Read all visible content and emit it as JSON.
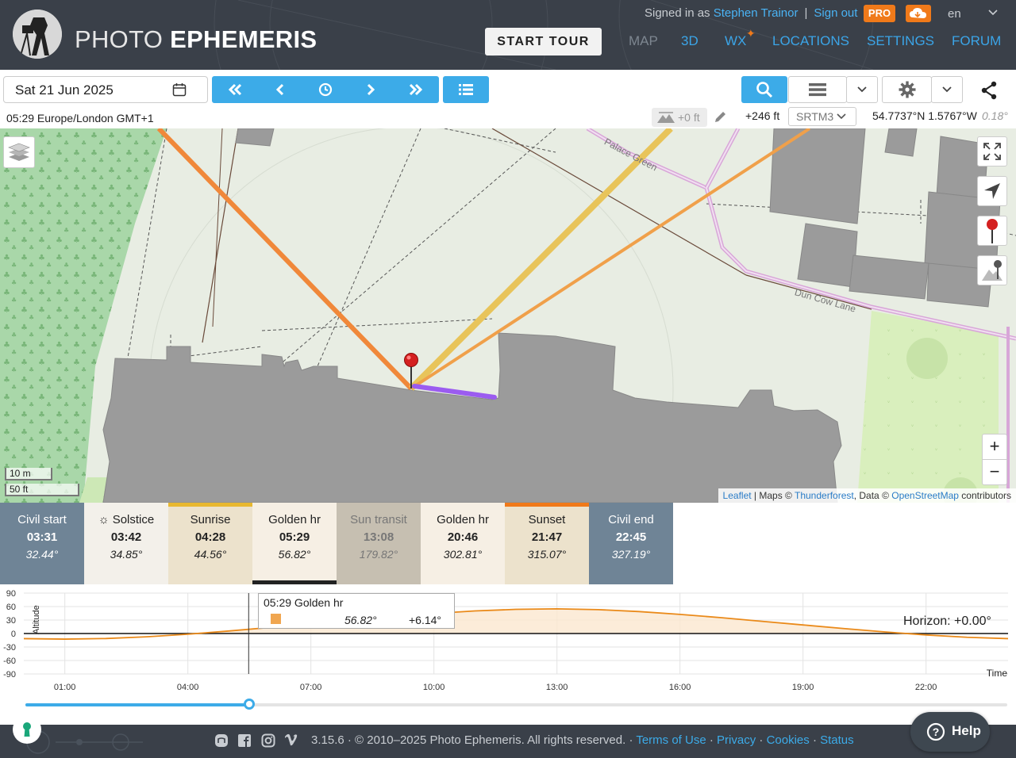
{
  "header": {
    "title_part1": "PHOTO",
    "title_part2": "EPHEMERIS",
    "signed_in_label": "Signed in as",
    "user_name": "Stephen Trainor",
    "sign_out": "Sign out",
    "pro_badge": "PRO",
    "language": "en",
    "start_tour": "START TOUR",
    "nav": {
      "map": "MAP",
      "three_d": "3D",
      "wx": "WX",
      "locations": "LOCATIONS",
      "settings": "SETTINGS",
      "forum": "FORUM"
    },
    "accent_color": "#3ba5e8",
    "brand_orange": "#f07a1a"
  },
  "toolbar": {
    "date": "Sat 21 Jun 2025"
  },
  "info": {
    "time_zone": "05:29 Europe/London GMT+1",
    "horizon_offset": "+0 ft",
    "elevation": "+246 ft",
    "elevation_source": "SRTM3",
    "coordinates": "54.7737°N 1.5767°W",
    "slope": "0.18°"
  },
  "map": {
    "label_street_1": "Palace Green",
    "label_street_2": "Dun Cow Lane",
    "scale_metric": "10 m",
    "scale_imperial": "50 ft",
    "zoom_in": "+",
    "zoom_out": "−",
    "attribution_leaflet": "Leaflet",
    "attribution_maps": " | Maps © ",
    "attribution_thunderforest": "Thunderforest",
    "attribution_data": ", Data © ",
    "attribution_osm": "OpenStreetMap",
    "attribution_contrib": " contributors"
  },
  "events": [
    {
      "label": "Civil start",
      "time": "03:31",
      "azimuth": "32.44°",
      "bg": "#6f8496",
      "fg": "#ffffff",
      "bar": ""
    },
    {
      "label": "Solstice",
      "time": "03:42",
      "azimuth": "34.85°",
      "bg": "#f3f0ea",
      "fg": "#222222",
      "bar": ""
    },
    {
      "label": "Sunrise",
      "time": "04:28",
      "azimuth": "44.56°",
      "bg": "#ece2cc",
      "fg": "#222222",
      "bar": "#e8b830"
    },
    {
      "label": "Golden hr",
      "time": "05:29",
      "azimuth": "56.82°",
      "bg": "#f6efe4",
      "fg": "#222222",
      "bar": ""
    },
    {
      "label": "Sun transit",
      "time": "13:08",
      "azimuth": "179.82°",
      "bg": "#c6bfb1",
      "fg": "#777777",
      "bar": ""
    },
    {
      "label": "Golden hr",
      "time": "20:46",
      "azimuth": "302.81°",
      "bg": "#f6efe4",
      "fg": "#222222",
      "bar": ""
    },
    {
      "label": "Sunset",
      "time": "21:47",
      "azimuth": "315.07°",
      "bg": "#ece2cc",
      "fg": "#222222",
      "bar": "#f07a1a"
    },
    {
      "label": "Civil end",
      "time": "22:45",
      "azimuth": "327.19°",
      "bg": "#6f8496",
      "fg": "#ffffff",
      "bar": ""
    }
  ],
  "chart_data": {
    "type": "line",
    "ylabel": "Altitude",
    "xlabel": "Time",
    "yticks": [
      "90",
      "60",
      "30",
      "0",
      "-30",
      "-60",
      "-90"
    ],
    "xticks": [
      "01:00",
      "04:00",
      "07:00",
      "10:00",
      "13:00",
      "16:00",
      "19:00",
      "22:00"
    ],
    "ylim": [
      -90,
      90
    ],
    "series": [
      {
        "x_hours": [
          0,
          1,
          2,
          3,
          4,
          5,
          6,
          7,
          8,
          9,
          10,
          11,
          12,
          13,
          14,
          15,
          16,
          17,
          18,
          19,
          20,
          21,
          22,
          23,
          24
        ],
        "values": [
          -11.4,
          -12.5,
          -11.1,
          -7.3,
          -1.5,
          5.6,
          13.4,
          21.6,
          29.8,
          37.6,
          44.6,
          50.3,
          53.8,
          54.9,
          53.2,
          48.9,
          42.6,
          35.3,
          27.2,
          19.1,
          11.1,
          3.6,
          -3.2,
          -8.4,
          -11.4
        ]
      }
    ],
    "horizon_label": "Horizon: +0.00°",
    "tooltip": {
      "title": "05:29 Golden hr",
      "azimuth": "56.82°",
      "altitude": "+6.14°"
    },
    "current_time_hours": 5.483
  },
  "timeline": {
    "position_fraction": 0.228
  },
  "footer": {
    "version": "3.15.6 · © 2010–2025 Photo Ephemeris. All rights reserved. · ",
    "terms": "Terms of Use",
    "dot1": " · ",
    "privacy": "Privacy",
    "dot2": " · ",
    "cookies": "Cookies",
    "dot3": " · ",
    "status": "Status",
    "help": "Help"
  }
}
